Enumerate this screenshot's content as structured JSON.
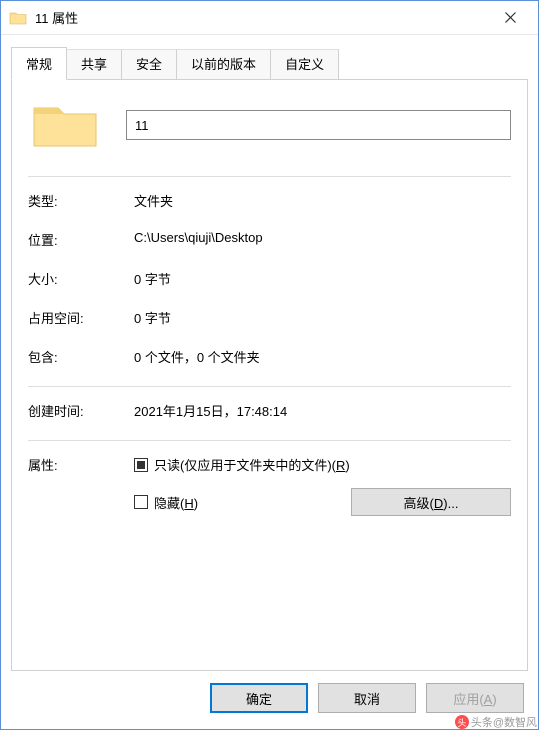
{
  "titlebar": {
    "title": "11 属性"
  },
  "tabs": {
    "general": "常规",
    "sharing": "共享",
    "security": "安全",
    "previous_versions": "以前的版本",
    "customize": "自定义"
  },
  "name_input_value": "11",
  "fields": {
    "type_label": "类型:",
    "type_value": "文件夹",
    "location_label": "位置:",
    "location_value": "C:\\Users\\qiuji\\Desktop",
    "size_label": "大小:",
    "size_value": "0 字节",
    "size_on_disk_label": "占用空间:",
    "size_on_disk_value": "0 字节",
    "contains_label": "包含:",
    "contains_value": "0 个文件，0 个文件夹",
    "created_label": "创建时间:",
    "created_value": "2021年1月15日，17:48:14",
    "attributes_label": "属性:"
  },
  "checkboxes": {
    "readonly_label": "只读(仅应用于文件夹中的文件)(",
    "readonly_key": "R",
    "readonly_suffix": ")",
    "hidden_label": "隐藏(",
    "hidden_key": "H",
    "hidden_suffix": ")"
  },
  "buttons": {
    "advanced": "高级(",
    "advanced_key": "D",
    "advanced_suffix": ")...",
    "ok": "确定",
    "cancel": "取消",
    "apply": "应用(",
    "apply_key": "A",
    "apply_suffix": ")"
  },
  "watermark": {
    "text": "头条@数智风"
  }
}
